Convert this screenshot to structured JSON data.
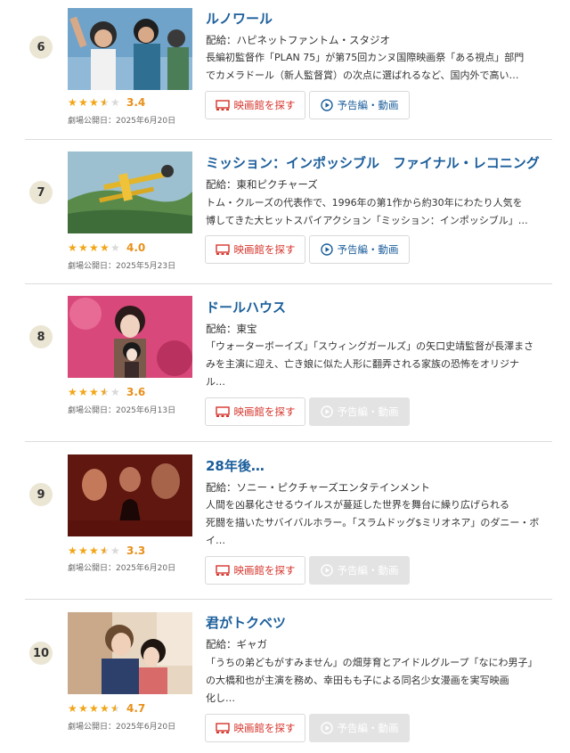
{
  "colors": {
    "title": "#1b5e9b",
    "theater_button": "#d6342b",
    "star": "#f2a516",
    "score": "#e8901a",
    "rank_badge": "#ebe5d4"
  },
  "labels": {
    "theater_button": "映画館を探す",
    "trailer_button": "予告編・動画"
  },
  "movies": [
    {
      "rank": "6",
      "title": "ルノワール",
      "distributor": "配給：ハピネットファントム・スタジオ",
      "desc1": "長編初監督作「PLAN 75」が第75回カンヌ国際映画祭「ある視点」部門",
      "desc2": "でカメラドール（新人監督賞）の次点に選ばれるなど、国内外で高い…",
      "desc3": "",
      "rating": 3.4,
      "score": "3.4",
      "release": "劇場公開日：2025年6月20日",
      "trailer_enabled": true
    },
    {
      "rank": "7",
      "title": "ミッション：インポッシブル　ファイナル・レコニング",
      "distributor": "配給：東和ピクチャーズ",
      "desc1": "トム・クルーズの代表作で、1996年の第1作から約30年にわたり人気を",
      "desc2": "博してきた大ヒットスパイアクション「ミッション：インポッシブル」…",
      "desc3": "",
      "rating": 4.0,
      "score": "4.0",
      "release": "劇場公開日：2025年5月23日",
      "trailer_enabled": true
    },
    {
      "rank": "8",
      "title": "ドールハウス",
      "distributor": "配給：東宝",
      "desc1": "「ウォーターボーイズ」「スウィングガールズ」の矢口史靖監督が長澤まさ",
      "desc2": "みを主演に迎え、亡き娘に似た人形に翻弄される家族の恐怖をオリジナ",
      "desc3": "ル…",
      "rating": 3.6,
      "score": "3.6",
      "release": "劇場公開日：2025年6月13日",
      "trailer_enabled": false
    },
    {
      "rank": "9",
      "title": "28年後…",
      "distributor": "配給：ソニー・ピクチャーズエンタテインメント",
      "desc1": "人間を凶暴化させるウイルスが蔓延した世界を舞台に繰り広げられる",
      "desc2": "死闘を描いたサバイバルホラー。「スラムドッグ$ミリオネア」のダニー・ボ",
      "desc3": "イ…",
      "rating": 3.3,
      "score": "3.3",
      "release": "劇場公開日：2025年6月20日",
      "trailer_enabled": false
    },
    {
      "rank": "10",
      "title": "君がトクベツ",
      "distributor": "配給：ギャガ",
      "desc1": "「うちの弟どもがすみません」の畑芽育とアイドルグループ「なにわ男子」",
      "desc2": "の大橋和也が主演を務め、幸田もも子による同名少女漫画を実写映画",
      "desc3": "化し…",
      "rating": 4.7,
      "score": "4.7",
      "release": "劇場公開日：2025年6月20日",
      "trailer_enabled": false
    }
  ]
}
